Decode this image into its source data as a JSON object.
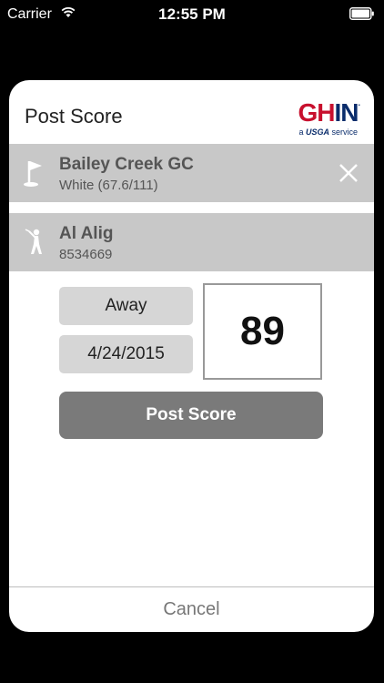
{
  "status_bar": {
    "carrier": "Carrier",
    "time": "12:55 PM"
  },
  "modal": {
    "title": "Post Score",
    "logo": {
      "brand_text": "GHIN",
      "tagline": "a USGA service"
    },
    "course": {
      "name": "Bailey Creek GC",
      "tees": "White (67.6/111)"
    },
    "player": {
      "name": "Al Alig",
      "ghin_number": "8534669"
    },
    "score_type": "Away",
    "date": "4/24/2015",
    "score": "89",
    "post_button_label": "Post Score",
    "cancel_label": "Cancel"
  },
  "colors": {
    "row_background": "#c8c8c8",
    "post_button": "#7a7a7a",
    "brand_red": "#c8102e",
    "brand_blue": "#0a2c6b"
  }
}
